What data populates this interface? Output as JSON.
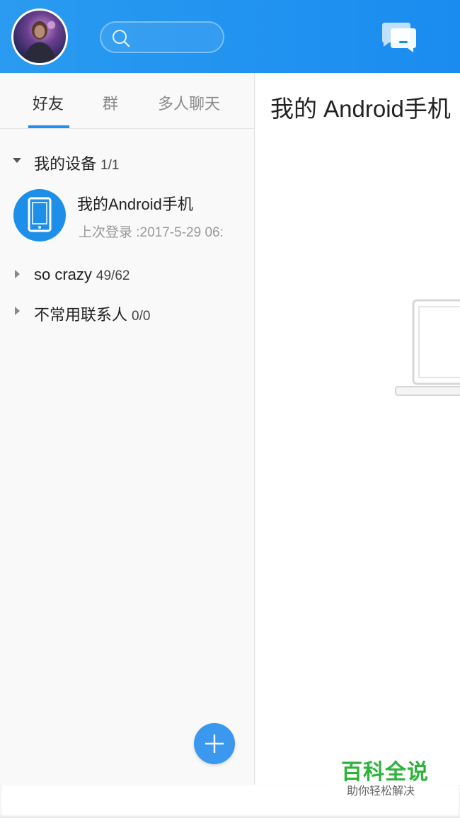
{
  "tabs": [
    {
      "label": "好友"
    },
    {
      "label": "群"
    },
    {
      "label": "多人聊天"
    }
  ],
  "groups": [
    {
      "name": "我的设备",
      "count": "1/1",
      "expanded": true
    },
    {
      "name": "so crazy",
      "count": "49/62",
      "expanded": false
    },
    {
      "name": "不常用联系人",
      "count": "0/0",
      "expanded": false
    }
  ],
  "device": {
    "name": "我的Android手机",
    "status": "上次登录 :2017-5-29 06:"
  },
  "chat": {
    "title": "我的 Android手机"
  },
  "watermark": {
    "title": "百科全说",
    "subtitle": "助你轻松解决"
  },
  "colors": {
    "header": "#1a8cf0",
    "accent": "#1e90f0",
    "watermark_green": "#2db33a"
  },
  "icons": {
    "search": "search-icon",
    "chat": "chat-bubbles-icon",
    "add": "plus-icon",
    "device": "tablet-icon",
    "laptop": "laptop-icon"
  }
}
